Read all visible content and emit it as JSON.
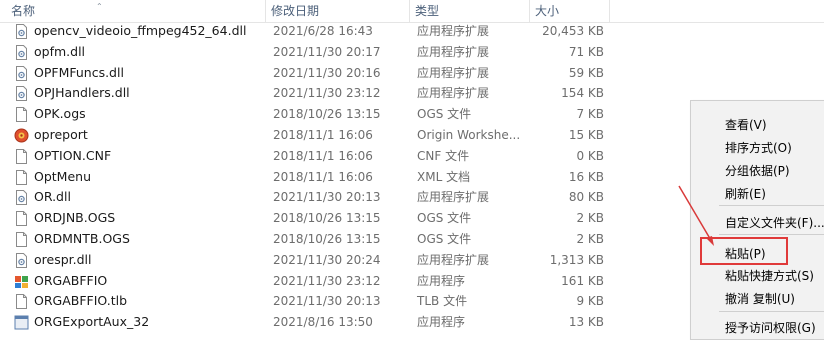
{
  "columns": {
    "name": "名称",
    "date": "修改日期",
    "type": "类型",
    "size": "大小"
  },
  "files": [
    {
      "icon": "dll-file-icon",
      "name": "opencv_videoio_ffmpeg452_64.dll",
      "date": "2021/6/28 16:43",
      "type": "应用程序扩展",
      "size": "20,453 KB"
    },
    {
      "icon": "dll-file-icon",
      "name": "opfm.dll",
      "date": "2021/11/30 20:17",
      "type": "应用程序扩展",
      "size": "71 KB"
    },
    {
      "icon": "dll-file-icon",
      "name": "OPFMFuncs.dll",
      "date": "2021/11/30 20:16",
      "type": "应用程序扩展",
      "size": "59 KB"
    },
    {
      "icon": "dll-file-icon",
      "name": "OPJHandlers.dll",
      "date": "2021/11/30 23:12",
      "type": "应用程序扩展",
      "size": "154 KB"
    },
    {
      "icon": "document-file-icon",
      "name": "OPK.ogs",
      "date": "2018/10/26 13:15",
      "type": "OGS 文件",
      "size": "7 KB"
    },
    {
      "icon": "origin-app-icon",
      "name": "opreport",
      "date": "2018/11/1 16:06",
      "type": "Origin Workshe...",
      "size": "15 KB"
    },
    {
      "icon": "document-file-icon",
      "name": "OPTION.CNF",
      "date": "2018/11/1 16:06",
      "type": "CNF 文件",
      "size": "0 KB"
    },
    {
      "icon": "document-file-icon",
      "name": "OptMenu",
      "date": "2018/11/1 16:06",
      "type": "XML 文档",
      "size": "16 KB"
    },
    {
      "icon": "dll-file-icon",
      "name": "OR.dll",
      "date": "2021/11/30 20:13",
      "type": "应用程序扩展",
      "size": "80 KB"
    },
    {
      "icon": "document-file-icon",
      "name": "ORDJNB.OGS",
      "date": "2018/10/26 13:15",
      "type": "OGS 文件",
      "size": "2 KB"
    },
    {
      "icon": "document-file-icon",
      "name": "ORDMNTB.OGS",
      "date": "2018/10/26 13:15",
      "type": "OGS 文件",
      "size": "2 KB"
    },
    {
      "icon": "dll-file-icon",
      "name": "orespr.dll",
      "date": "2021/11/30 20:24",
      "type": "应用程序扩展",
      "size": "1,313 KB"
    },
    {
      "icon": "application-icon",
      "name": "ORGABFFIO",
      "date": "2021/11/30 23:12",
      "type": "应用程序",
      "size": "161 KB"
    },
    {
      "icon": "document-file-icon",
      "name": "ORGABFFIO.tlb",
      "date": "2021/11/30 20:13",
      "type": "TLB 文件",
      "size": "9 KB"
    },
    {
      "icon": "application-icon",
      "name": "ORGExportAux_32",
      "date": "2021/8/16 13:50",
      "type": "应用程序",
      "size": "13 KB"
    }
  ],
  "context_menu": {
    "view": "查看(V)",
    "sort": "排序方式(O)",
    "group": "分组依据(P)",
    "refresh": "刷新(E)",
    "customize": "自定义文件夹(F)...",
    "paste": "粘贴(P)",
    "paste_shortcut": "粘贴快捷方式(S)",
    "undo_copy": "撤消 复制(U)",
    "next_partial": "授予访问权限(G)"
  },
  "colors": {
    "highlight_box": "#e03a3a",
    "arrow": "#d93a3a"
  }
}
